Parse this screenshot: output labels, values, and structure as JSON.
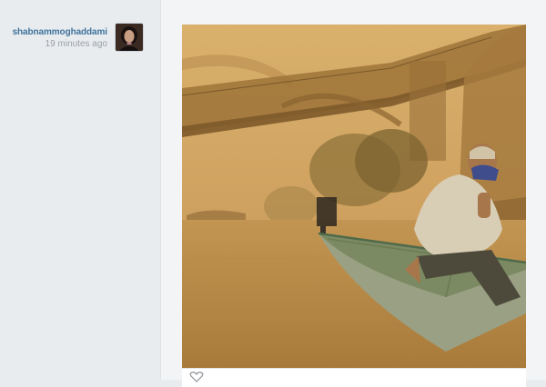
{
  "post": {
    "username": "shabnammoghaddami",
    "timestamp": "19 minutes ago"
  },
  "colors": {
    "username_link": "#3f729b",
    "timestamp": "#9aa0a6",
    "page_background": "#e9ecef",
    "photo_tone": "#c79a55"
  },
  "icons": {
    "avatar": "profile-photo",
    "like": "heart-icon"
  }
}
